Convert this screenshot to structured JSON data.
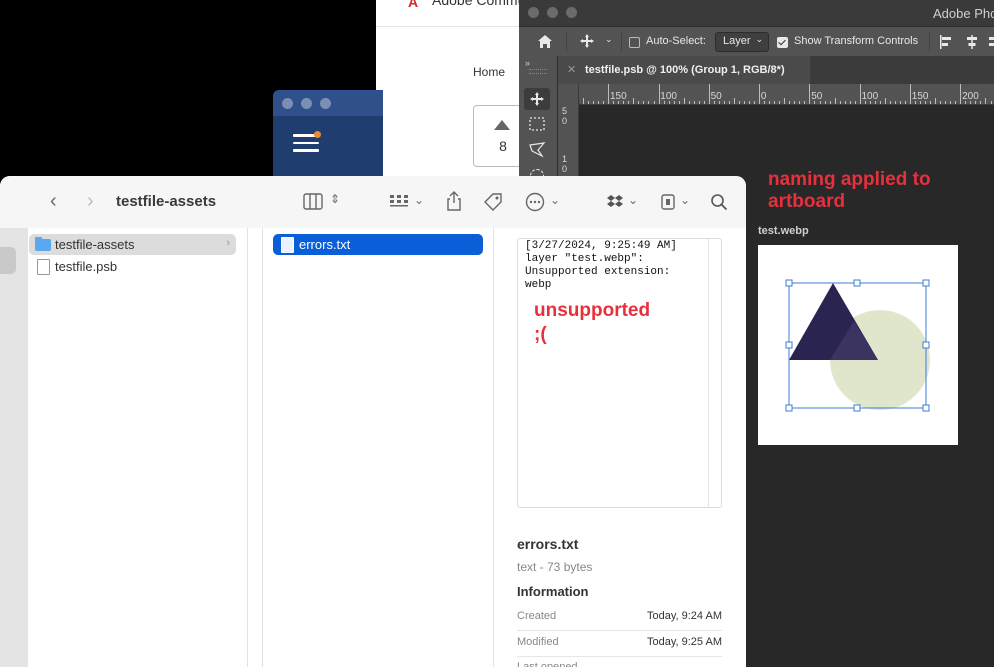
{
  "web": {
    "logo_text": "Adobe Community",
    "nav_home": "Home",
    "vote_count": "8"
  },
  "photoshop": {
    "app_title": "Adobe Photoshop",
    "auto_select_label": "Auto-Select:",
    "auto_select_value": "Layer",
    "show_transform_label": "Show Transform Controls",
    "doc_tab": "testfile.psb @ 100% (Group 1, RGB/8*)",
    "ruler_labels": [
      "150",
      "100",
      "50",
      "0",
      "50",
      "100",
      "150",
      "200"
    ],
    "vruler_labels": [
      "5",
      "0",
      "1",
      "0"
    ],
    "annotation": "naming applied to\nartboard",
    "artboard_name": "test.webp"
  },
  "finder": {
    "title": "testfile-assets",
    "sidebar_items": [
      {
        "label": "testfile-assets",
        "type": "folder",
        "selected": true
      },
      {
        "label": "testfile.psb",
        "type": "file",
        "selected": false
      }
    ],
    "column2_items": [
      {
        "label": "errors.txt",
        "selected": true
      }
    ],
    "preview_text": "[3/27/2024, 9:25:49 AM]\nlayer \"test.webp\":\nUnsupported extension:\nwebp",
    "preview_note": "unsupported\n;(",
    "file_name": "errors.txt",
    "file_meta": "text - 73 bytes",
    "info_heading": "Information",
    "info_rows": [
      {
        "key": "Created",
        "value": "Today, 9:24 AM"
      },
      {
        "key": "Modified",
        "value": "Today, 9:25 AM"
      },
      {
        "key": "Last opened",
        "value": ""
      }
    ]
  },
  "colors": {
    "selection_blue": "#0a5fd8",
    "annotation_red": "#e8303c",
    "triangle": "#2a2550",
    "circle": "#dfe6cc"
  }
}
